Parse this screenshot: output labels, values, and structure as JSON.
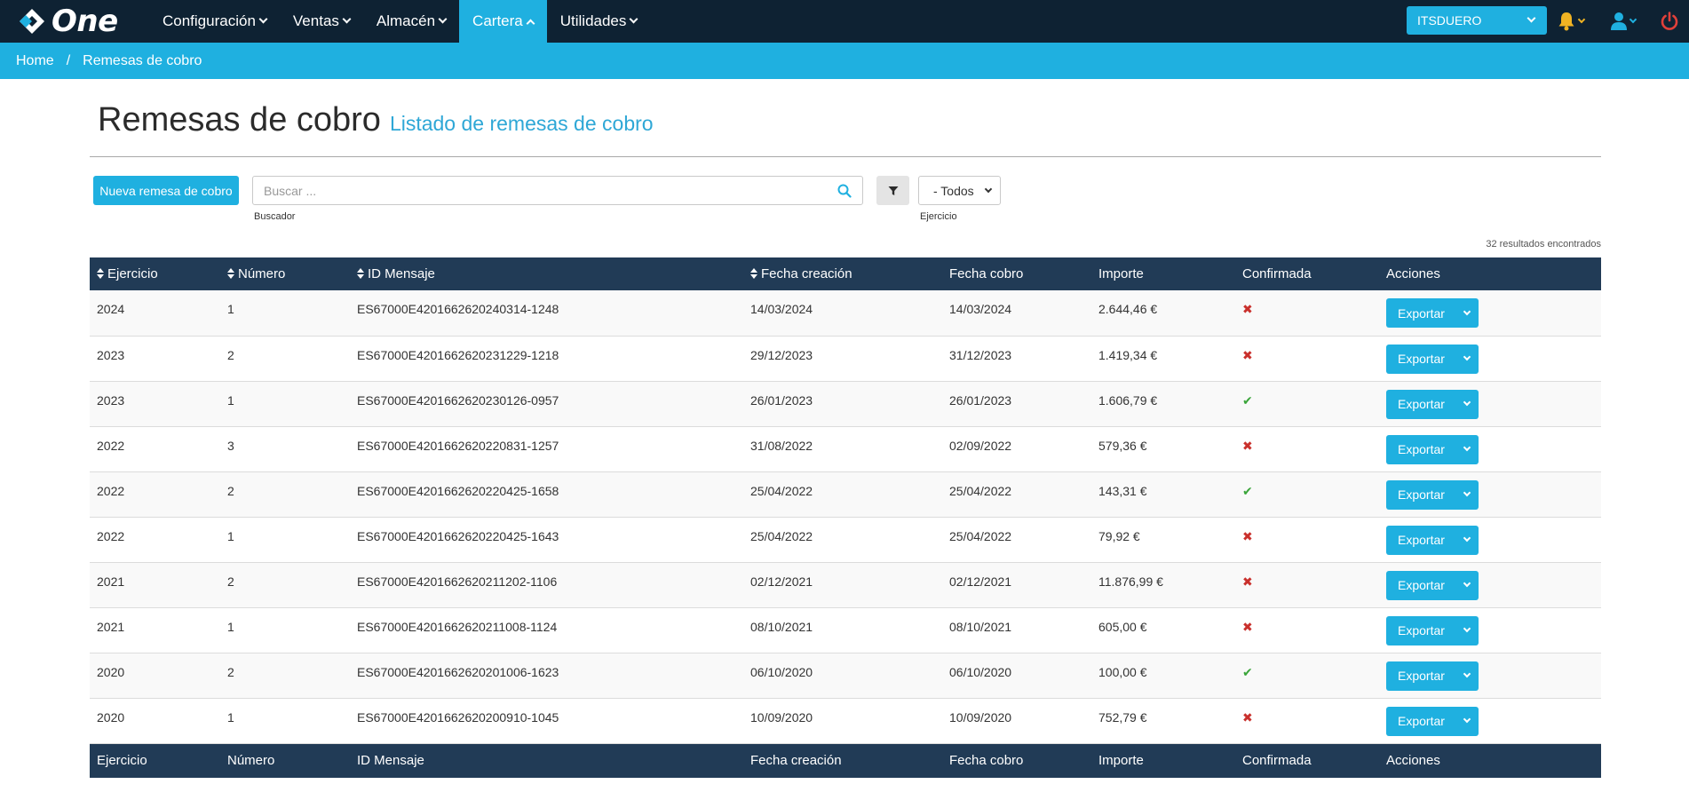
{
  "app": {
    "name": "One"
  },
  "nav": {
    "items": [
      {
        "label": "Configuración",
        "active": false
      },
      {
        "label": "Ventas",
        "active": false
      },
      {
        "label": "Almacén",
        "active": false
      },
      {
        "label": "Cartera",
        "active": true
      },
      {
        "label": "Utilidades",
        "active": false
      }
    ],
    "company": "ITSDUERO",
    "icons": [
      "bell-icon",
      "user-icon",
      "power-icon"
    ]
  },
  "breadcrumb": {
    "home": "Home",
    "separator": "/",
    "current": "Remesas de cobro"
  },
  "page": {
    "title": "Remesas de cobro",
    "subtitle": "Listado de remesas de cobro"
  },
  "toolbar": {
    "new_label": "Nueva remesa de cobro",
    "search_placeholder": "Buscar ...",
    "search_value": "",
    "search_caption": "Buscador",
    "year_value": "- Todos",
    "year_caption": "Ejercicio",
    "results_text": "32 resultados encontrados"
  },
  "table": {
    "columns": [
      "Ejercicio",
      "Número",
      "ID Mensaje",
      "Fecha creación",
      "Fecha cobro",
      "Importe",
      "Confirmada",
      "Acciones"
    ],
    "sortable": [
      true,
      true,
      true,
      true,
      false,
      false,
      false,
      false
    ],
    "export_label": "Exportar",
    "rows": [
      {
        "ejercicio": "2024",
        "numero": "1",
        "id": "ES67000E4201662620240314-1248",
        "creacion": "14/03/2024",
        "cobro": "14/03/2024",
        "importe": "2.644,46 €",
        "confirmada": false
      },
      {
        "ejercicio": "2023",
        "numero": "2",
        "id": "ES67000E4201662620231229-1218",
        "creacion": "29/12/2023",
        "cobro": "31/12/2023",
        "importe": "1.419,34 €",
        "confirmada": false
      },
      {
        "ejercicio": "2023",
        "numero": "1",
        "id": "ES67000E4201662620230126-0957",
        "creacion": "26/01/2023",
        "cobro": "26/01/2023",
        "importe": "1.606,79 €",
        "confirmada": true
      },
      {
        "ejercicio": "2022",
        "numero": "3",
        "id": "ES67000E4201662620220831-1257",
        "creacion": "31/08/2022",
        "cobro": "02/09/2022",
        "importe": "579,36 €",
        "confirmada": false
      },
      {
        "ejercicio": "2022",
        "numero": "2",
        "id": "ES67000E4201662620220425-1658",
        "creacion": "25/04/2022",
        "cobro": "25/04/2022",
        "importe": "143,31 €",
        "confirmada": true
      },
      {
        "ejercicio": "2022",
        "numero": "1",
        "id": "ES67000E4201662620220425-1643",
        "creacion": "25/04/2022",
        "cobro": "25/04/2022",
        "importe": "79,92 €",
        "confirmada": false
      },
      {
        "ejercicio": "2021",
        "numero": "2",
        "id": "ES67000E4201662620211202-1106",
        "creacion": "02/12/2021",
        "cobro": "02/12/2021",
        "importe": "11.876,99 €",
        "confirmada": false
      },
      {
        "ejercicio": "2021",
        "numero": "1",
        "id": "ES67000E4201662620211008-1124",
        "creacion": "08/10/2021",
        "cobro": "08/10/2021",
        "importe": "605,00 €",
        "confirmada": false
      },
      {
        "ejercicio": "2020",
        "numero": "2",
        "id": "ES67000E4201662620201006-1623",
        "creacion": "06/10/2020",
        "cobro": "06/10/2020",
        "importe": "100,00 €",
        "confirmada": true
      },
      {
        "ejercicio": "2020",
        "numero": "1",
        "id": "ES67000E4201662620200910-1045",
        "creacion": "10/09/2020",
        "cobro": "10/09/2020",
        "importe": "752,79 €",
        "confirmada": false
      }
    ]
  },
  "colors": {
    "navbar": "#0e2233",
    "accent": "#1fb0e0",
    "table_header": "#213b56",
    "confirmed": "#3aa53a",
    "unconfirmed": "#c9302c",
    "bell": "#f0b323",
    "power": "#e0403a"
  }
}
